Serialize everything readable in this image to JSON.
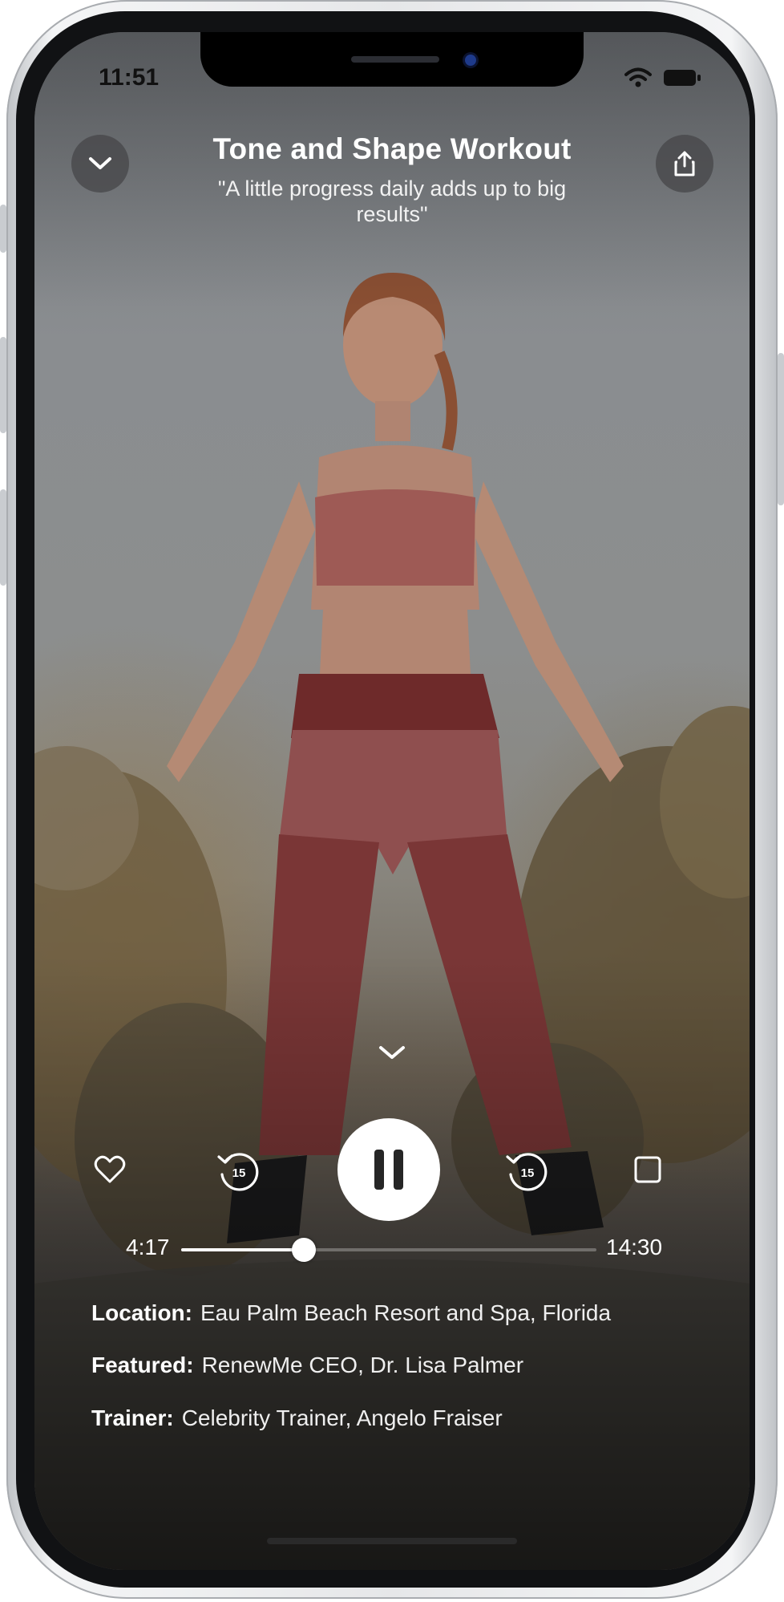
{
  "status_bar": {
    "time": "11:51"
  },
  "header": {
    "title": "Tone and Shape Workout",
    "subtitle": "\"A little progress daily adds up to big results\""
  },
  "player": {
    "elapsed": "4:17",
    "duration": "14:30",
    "progress_fraction": 0.295,
    "skip_back_seconds": "15",
    "skip_forward_seconds": "15"
  },
  "details": [
    {
      "key": "Location:",
      "value": "Eau Palm Beach Resort and Spa, Florida"
    },
    {
      "key": "Featured:",
      "value": "RenewMe CEO, Dr. Lisa Palmer"
    },
    {
      "key": "Trainer:",
      "value": "Celebrity Trainer, Angelo Fraiser"
    }
  ],
  "icons": {
    "minimize": "chevron-down-icon",
    "share": "share-icon",
    "collapse": "chevron-down-icon",
    "favorite": "heart-icon",
    "rewind": "rewind-15-icon",
    "play_pause": "pause-icon",
    "forward": "forward-15-icon",
    "stop": "stop-icon"
  }
}
